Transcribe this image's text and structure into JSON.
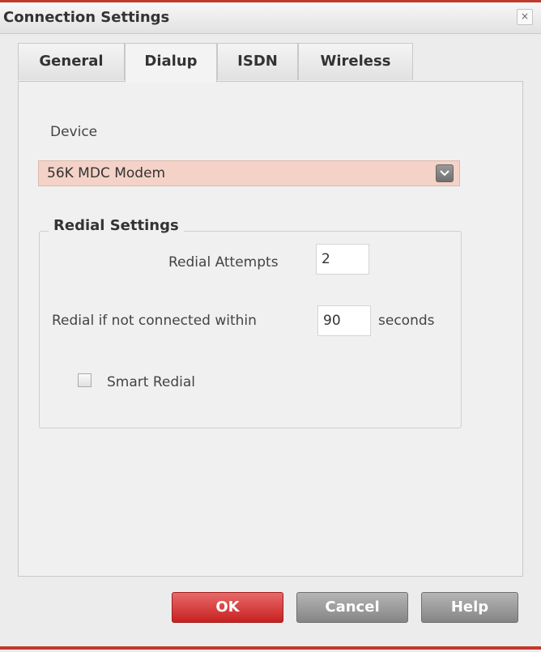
{
  "window": {
    "title": "Connection Settings",
    "close_glyph": "×"
  },
  "tabs": [
    {
      "label": "General",
      "active": false
    },
    {
      "label": "Dialup",
      "active": true
    },
    {
      "label": "ISDN",
      "active": false
    },
    {
      "label": "Wireless",
      "active": false
    }
  ],
  "device": {
    "label": "Device",
    "selected": "56K MDC Modem"
  },
  "redial": {
    "group_title": "Redial Settings",
    "attempts_label": "Redial Attempts",
    "attempts_value": "2",
    "within_label": "Redial if not connected within",
    "within_value": "90",
    "within_unit": "seconds",
    "smart_label": "Smart Redial",
    "smart_checked": false
  },
  "buttons": {
    "ok": "OK",
    "cancel": "Cancel",
    "help": "Help"
  },
  "colors": {
    "accent": "#c0392b",
    "select_bg": "#f4d2c8"
  }
}
